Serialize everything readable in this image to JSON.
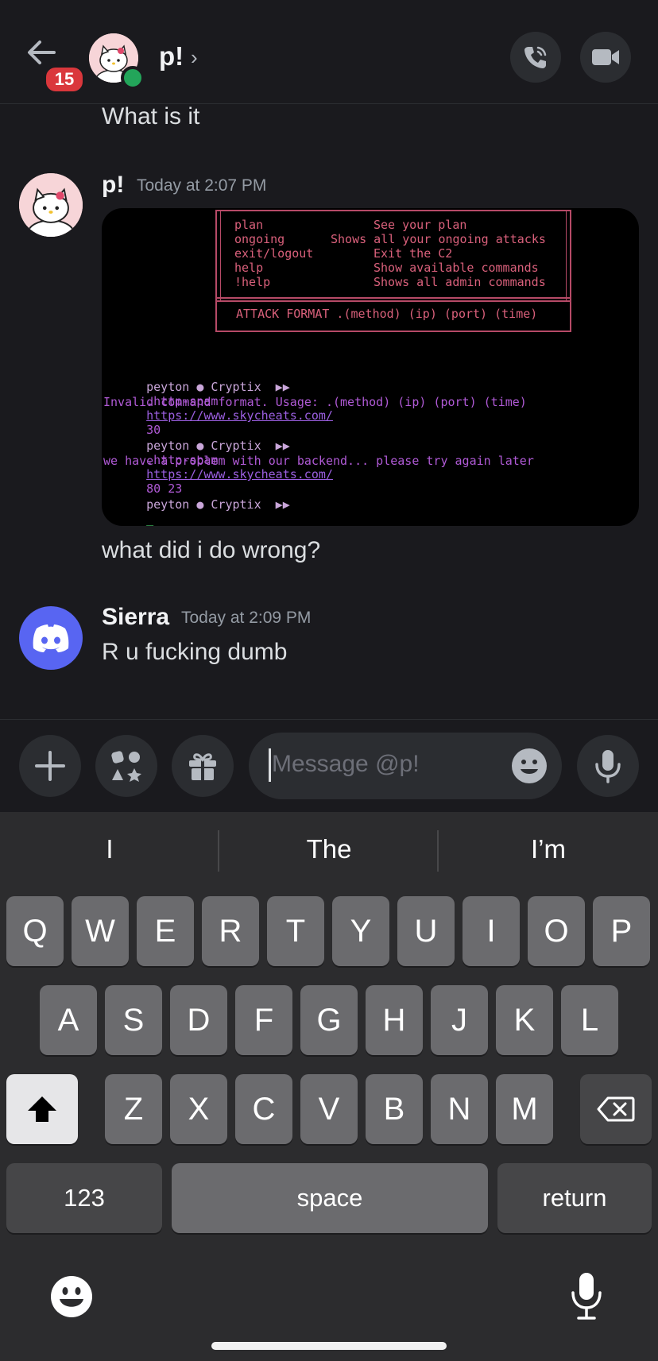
{
  "header": {
    "badge_count": "15",
    "dm_name": "p!",
    "chevron": "›"
  },
  "messages": {
    "prev_text": "What is it",
    "p_author": "p!",
    "p_timestamp": "Today at 2:07 PM",
    "p_text": "what did i do wrong?",
    "sierra_author": "Sierra",
    "sierra_timestamp": "Today at 2:09 PM",
    "sierra_text": "R u fucking dumb"
  },
  "terminal": {
    "help_rows": [
      {
        "cmd": "plan",
        "desc": "See your plan"
      },
      {
        "cmd": "ongoing",
        "desc": "Shows all your ongoing attacks"
      },
      {
        "cmd": "exit/logout",
        "desc": "Exit the C2"
      },
      {
        "cmd": "help",
        "desc": "Show available commands"
      },
      {
        "cmd": "!help",
        "desc": "Shows all admin commands"
      }
    ],
    "attack_format": "ATTACK FORMAT .(method) (ip) (port) (time)",
    "prompt": "peyton ● Cryptix  ▶▶",
    "cmd1": ".http-spam",
    "url": "https://www.skycheats.com/",
    "cmd1_args": "30",
    "error1": "Invalid command format. Usage: .(method) (ip) (port) (time)",
    "cmd2_args": "80 23",
    "error2": "we have a problem with our backend... please try again later",
    "cursor": "_"
  },
  "composer": {
    "placeholder": "Message @p!"
  },
  "keyboard": {
    "suggestions": [
      "I",
      "The",
      "I’m"
    ],
    "row1": [
      "Q",
      "W",
      "E",
      "R",
      "T",
      "Y",
      "U",
      "I",
      "O",
      "P"
    ],
    "row2": [
      "A",
      "S",
      "D",
      "F",
      "G",
      "H",
      "J",
      "K",
      "L"
    ],
    "row3": [
      "Z",
      "X",
      "C",
      "V",
      "B",
      "N",
      "M"
    ],
    "numbers_key": "123",
    "space_key": "space",
    "return_key": "return"
  },
  "colors": {
    "accent": "#5865f2",
    "status_online": "#23a55a",
    "badge": "#da373c"
  },
  "icons": [
    "back-arrow-icon",
    "phone-call-icon",
    "video-camera-icon",
    "plus-icon",
    "apps-icon",
    "gift-icon",
    "emoji-icon",
    "microphone-icon",
    "shift-icon",
    "backspace-icon",
    "discord-logo-icon"
  ]
}
